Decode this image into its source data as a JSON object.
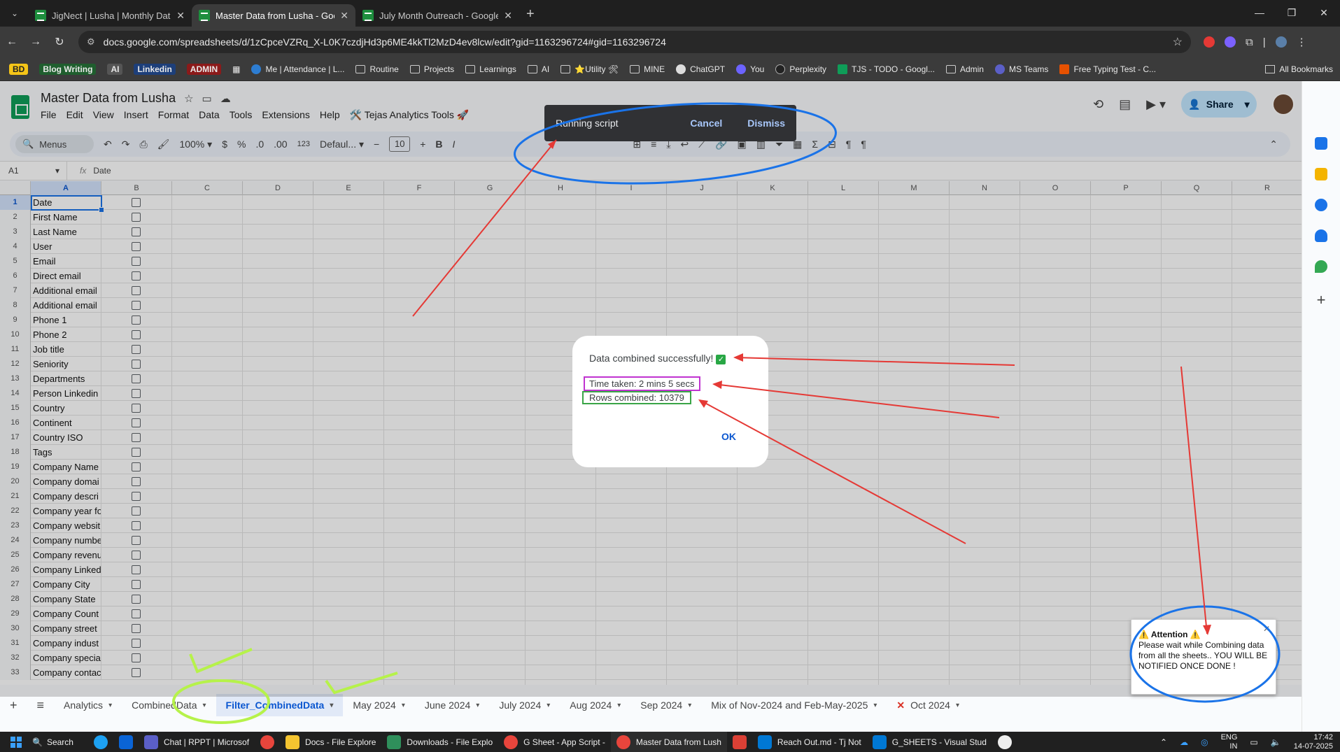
{
  "browser": {
    "tabs": [
      {
        "title": "JigNect | Lusha | Monthly Data",
        "active": false
      },
      {
        "title": "Master Data from Lusha - Goog",
        "active": true
      },
      {
        "title": "July Month Outreach - Google",
        "active": false
      }
    ],
    "url": "docs.google.com/spreadsheets/d/1zCpceVZRq_X-L0K7czdjHd3p6ME4kkTl2MzD4ev8lcw/edit?gid=1163296724#gid=1163296724",
    "bookmarks": [
      "BD",
      "Blog Writing",
      "AI",
      "Linkedin",
      "ADMIN",
      "Me | Attendance | L...",
      "Routine",
      "Projects",
      "Learnings",
      "AI",
      "⭐Utility 🛠",
      "MINE",
      "ChatGPT",
      "You",
      "Perplexity",
      "TJS - TODO - Googl...",
      "Admin",
      "MS Teams",
      "Free Typing Test - C..."
    ],
    "all_bookmarks": "All Bookmarks"
  },
  "doc": {
    "title": "Master Data from Lusha",
    "menus": [
      "File",
      "Edit",
      "View",
      "Insert",
      "Format",
      "Data",
      "Tools",
      "Extensions",
      "Help",
      "🛠️ Tejas Analytics Tools 🚀"
    ],
    "share": "Share",
    "toolbar": {
      "menus": "Menus",
      "zoom": "100%",
      "currency": "$",
      "percent": "%",
      "dec_dec": ".0",
      "inc_dec": ".00",
      "numfmt": "123",
      "font": "Defaul...",
      "font_size": "10"
    },
    "namebox": "A1",
    "formula": "Date"
  },
  "grid": {
    "columns": [
      "A",
      "B",
      "C",
      "D",
      "E",
      "F",
      "G",
      "H",
      "I",
      "J",
      "K",
      "L",
      "M",
      "N",
      "O",
      "P",
      "Q",
      "R"
    ],
    "rows": [
      {
        "n": "1",
        "a": "Date"
      },
      {
        "n": "2",
        "a": "First Name"
      },
      {
        "n": "3",
        "a": "Last Name"
      },
      {
        "n": "4",
        "a": "User"
      },
      {
        "n": "5",
        "a": "Email"
      },
      {
        "n": "6",
        "a": "Direct email"
      },
      {
        "n": "7",
        "a": "Additional email"
      },
      {
        "n": "8",
        "a": "Additional email"
      },
      {
        "n": "9",
        "a": "Phone 1"
      },
      {
        "n": "10",
        "a": "Phone 2"
      },
      {
        "n": "11",
        "a": "Job title"
      },
      {
        "n": "12",
        "a": "Seniority"
      },
      {
        "n": "13",
        "a": "Departments"
      },
      {
        "n": "14",
        "a": "Person Linkedin"
      },
      {
        "n": "15",
        "a": "Country"
      },
      {
        "n": "16",
        "a": "Continent"
      },
      {
        "n": "17",
        "a": "Country ISO"
      },
      {
        "n": "18",
        "a": "Tags"
      },
      {
        "n": "19",
        "a": "Company Name"
      },
      {
        "n": "20",
        "a": "Company domai"
      },
      {
        "n": "21",
        "a": "Company descri"
      },
      {
        "n": "22",
        "a": "Company year fo"
      },
      {
        "n": "23",
        "a": "Company websit"
      },
      {
        "n": "24",
        "a": "Company numbe"
      },
      {
        "n": "25",
        "a": "Company revenu"
      },
      {
        "n": "26",
        "a": "Company Linked"
      },
      {
        "n": "27",
        "a": "Company City"
      },
      {
        "n": "28",
        "a": "Company State"
      },
      {
        "n": "29",
        "a": "Company Count"
      },
      {
        "n": "30",
        "a": "Company street"
      },
      {
        "n": "31",
        "a": "Company indust"
      },
      {
        "n": "32",
        "a": "Company specia"
      },
      {
        "n": "33",
        "a": "Company contac"
      }
    ]
  },
  "sheet_tabs": [
    {
      "label": "Analytics",
      "active": false
    },
    {
      "label": "CombinedData",
      "active": false
    },
    {
      "label": "Filter_CombinedData",
      "active": true
    },
    {
      "label": "May 2024",
      "active": false
    },
    {
      "label": "June 2024",
      "active": false
    },
    {
      "label": "July 2024",
      "active": false
    },
    {
      "label": "Aug 2024",
      "active": false
    },
    {
      "label": "Sep 2024",
      "active": false
    },
    {
      "label": "Mix of Nov-2024 and Feb-May-2025",
      "active": false
    },
    {
      "label": "Oct 2024",
      "active": false
    }
  ],
  "running_script": {
    "label": "Running script",
    "cancel": "Cancel",
    "dismiss": "Dismiss"
  },
  "dialog": {
    "message": "Data combined successfully!",
    "time_taken": "Time taken: 2 mins 5 secs",
    "rows_combined": "Rows combined: 10379",
    "ok": "OK"
  },
  "toast": {
    "title": "Attention",
    "body": "Please wait while Combining data from all the sheets.. YOU WILL BE NOTIFIED ONCE DONE !"
  },
  "taskbar": {
    "search": "Search",
    "apps": [
      "Chat | RPPT | Microsof",
      "Docs - File Explore",
      "Downloads - File Explo",
      "G Sheet - App Script -",
      "Master Data from Lush",
      "Reach Out.md - Tj Not",
      "G_SHEETS - Visual Stud"
    ],
    "lang1": "ENG",
    "lang2": "IN",
    "time": "17:42",
    "date": "14-07-2025"
  },
  "colors": {
    "accent": "#0b57d0",
    "sheet_green": "#0f9d58",
    "annotation_blue": "#1a73e8",
    "annotation_red": "#e53935",
    "annotation_lime": "#b6f24a"
  }
}
